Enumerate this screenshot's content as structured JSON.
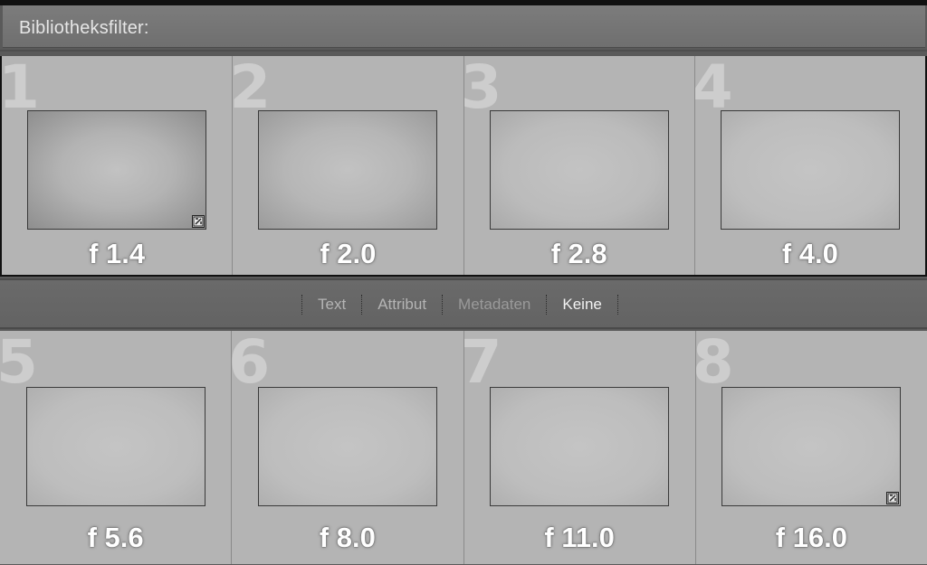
{
  "header": {
    "title": "Bibliotheksfilter:"
  },
  "filter_bar": {
    "tabs": [
      {
        "label": "Text",
        "state": "normal"
      },
      {
        "label": "Attribut",
        "state": "normal"
      },
      {
        "label": "Metadaten",
        "state": "dim"
      },
      {
        "label": "Keine",
        "state": "active"
      }
    ]
  },
  "cells": [
    {
      "number": "1",
      "label": "f 1.4",
      "badge": true
    },
    {
      "number": "2",
      "label": "f 2.0",
      "badge": false
    },
    {
      "number": "3",
      "label": "f 2.8",
      "badge": false
    },
    {
      "number": "4",
      "label": "f 4.0",
      "badge": false
    },
    {
      "number": "5",
      "label": "f 5.6",
      "badge": false
    },
    {
      "number": "6",
      "label": "f 8.0",
      "badge": false
    },
    {
      "number": "7",
      "label": "f 11.0",
      "badge": false
    },
    {
      "number": "8",
      "label": "f 16.0",
      "badge": true
    }
  ],
  "colors": {
    "cell_bg": "#b4b4b4",
    "panel_bg": "#6f6f6f",
    "active_tab": "#f2f2f2"
  }
}
